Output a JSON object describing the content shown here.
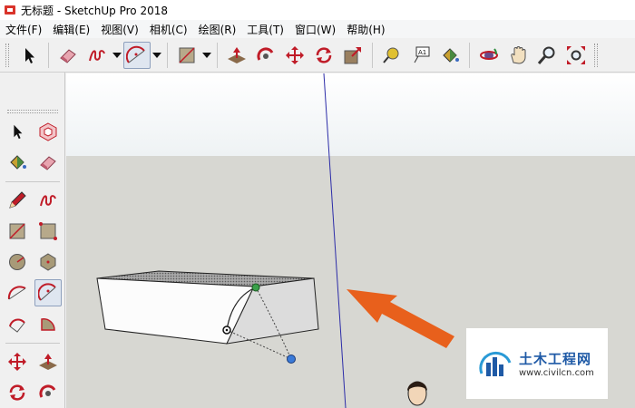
{
  "window": {
    "title": "无标题 - SketchUp Pro 2018"
  },
  "menu": [
    "文件(F)",
    "编辑(E)",
    "视图(V)",
    "相机(C)",
    "绘图(R)",
    "工具(T)",
    "窗口(W)",
    "帮助(H)"
  ],
  "toolbar": {
    "icons": [
      "select-icon",
      "eraser-icon",
      "freehand-icon",
      "arc-icon",
      "rectangle-icon",
      "push-pull-icon",
      "follow-me-icon",
      "move-icon",
      "rotate-icon",
      "scale-icon",
      "tape-measure-icon",
      "text-icon",
      "paint-bucket-icon",
      "orbit-icon",
      "pan-icon",
      "zoom-icon",
      "zoom-extents-icon"
    ],
    "active_tool": "arc-icon"
  },
  "watermark": {
    "title": "土木工程网",
    "url": "www.civilcn.com"
  },
  "colors": {
    "accent": "#e8601c",
    "blue_axis": "#2c2ca8",
    "watermark_blue": "#1f5aa6"
  }
}
